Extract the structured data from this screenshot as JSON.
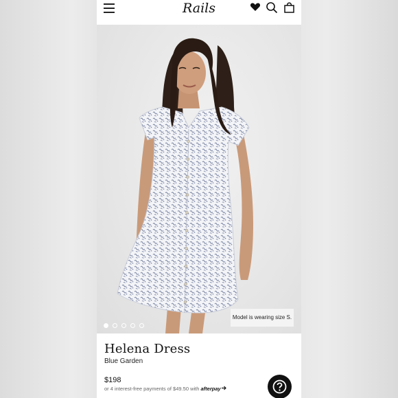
{
  "header": {
    "logo_text": "Rails",
    "icons": [
      "menu-icon",
      "heart-icon",
      "search-icon",
      "bag-icon"
    ]
  },
  "gallery": {
    "size_note": "Model is wearing size S.",
    "slide_count": 5,
    "active_slide": 1
  },
  "product": {
    "name": "Helena Dress",
    "color": "Blue Garden",
    "price": "$198",
    "installment_text": "or 4 interest-free payments of $49.50 with",
    "installment_brand": "afterpay"
  },
  "colors": {
    "text": "#111111",
    "help_button": "#111111"
  }
}
